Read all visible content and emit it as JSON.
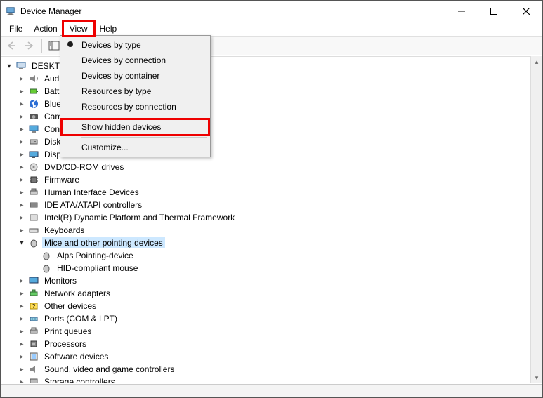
{
  "window": {
    "title": "Device Manager"
  },
  "menubar": {
    "file": "File",
    "action": "Action",
    "view": "View",
    "help": "Help"
  },
  "viewMenu": {
    "byType": "Devices by type",
    "byConnection": "Devices by connection",
    "byContainer": "Devices by container",
    "resByType": "Resources by type",
    "resByConnection": "Resources by connection",
    "showHidden": "Show hidden devices",
    "customize": "Customize..."
  },
  "tree": {
    "root": "DESKTO",
    "items": [
      "Aud",
      "Batt",
      "Blue",
      "Cam",
      "Con",
      "Disk",
      "Disp",
      "DVD/CD-ROM drives",
      "Firmware",
      "Human Interface Devices",
      "IDE ATA/ATAPI controllers",
      "Intel(R) Dynamic Platform and Thermal Framework",
      "Keyboards",
      "Mice and other pointing devices",
      "Monitors",
      "Network adapters",
      "Other devices",
      "Ports (COM & LPT)",
      "Print queues",
      "Processors",
      "Software devices",
      "Sound, video and game controllers",
      "Storage controllers"
    ],
    "miceChildren": [
      "Alps Pointing-device",
      "HID-compliant mouse"
    ]
  }
}
